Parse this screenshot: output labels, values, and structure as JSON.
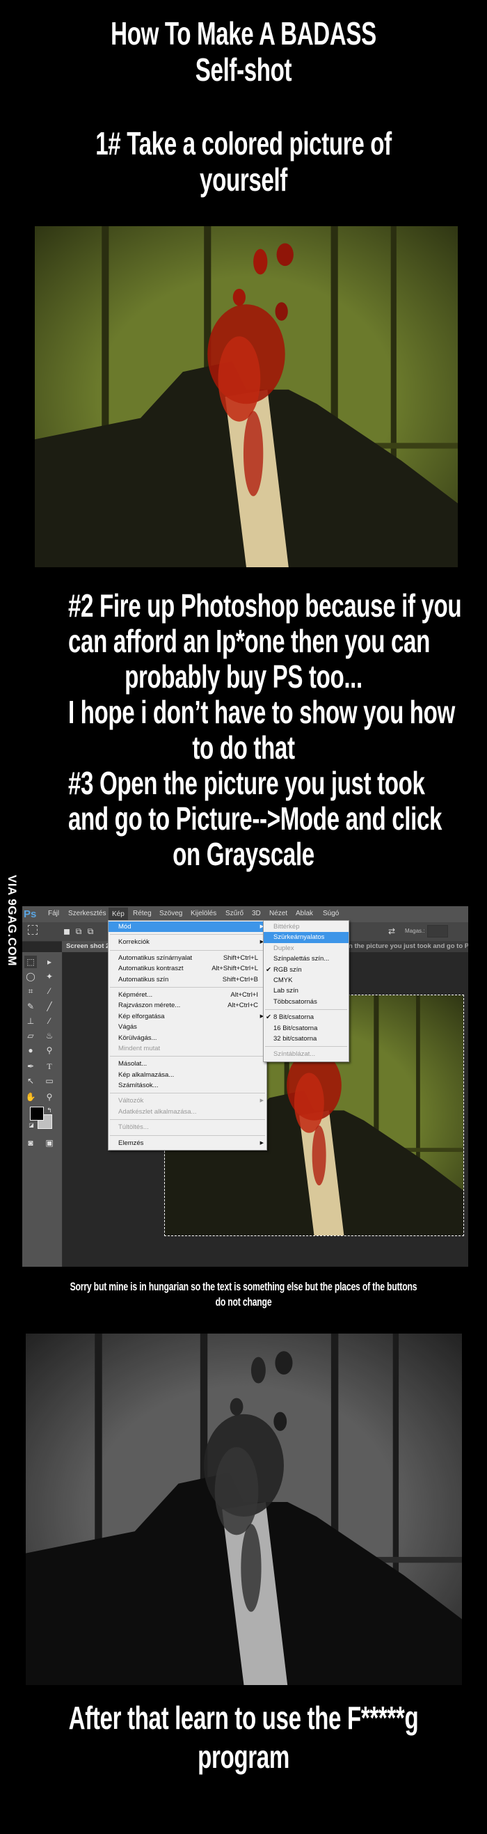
{
  "title_lines": [
    "How To Make A BADASS",
    "Self-shot"
  ],
  "step1_lines": [
    "1# Take a colored picture of",
    "yourself"
  ],
  "step2_lines": [
    "#2 Fire up Photoshop because if you",
    "can afford an Ip*one then you can",
    "probably buy PS too...",
    "I hope i don’t have to show you how",
    "to do that",
    "#3 Open the picture you just took",
    "and go to Picture-->Mode and click",
    "on Grayscale"
  ],
  "watermark": "VIA 9GAG.COM",
  "photoshop": {
    "logo": "Ps",
    "menubar": [
      "Fájl",
      "Szerkesztés",
      "Kép",
      "Réteg",
      "Szöveg",
      "Kijelölés",
      "Szűrő",
      "3D",
      "Nézet",
      "Ablak",
      "Súgó"
    ],
    "active_menu": "Kép",
    "options": {
      "height_label": "Magas.:"
    },
    "tab_label": "Screen shot 2",
    "tab_overflow_text": "n the picture you just took and go to Pic",
    "kep_menu": [
      {
        "label": "Mód",
        "submenu": true,
        "highlighted": true
      },
      {
        "sep": true
      },
      {
        "label": "Korrekciók",
        "submenu": true
      },
      {
        "sep": true
      },
      {
        "label": "Automatikus színárnyalat",
        "shortcut": "Shift+Ctrl+L"
      },
      {
        "label": "Automatikus kontraszt",
        "shortcut": "Alt+Shift+Ctrl+L"
      },
      {
        "label": "Automatikus szín",
        "shortcut": "Shift+Ctrl+B"
      },
      {
        "sep": true
      },
      {
        "label": "Képméret...",
        "shortcut": "Alt+Ctrl+I"
      },
      {
        "label": "Rajzvászon mérete...",
        "shortcut": "Alt+Ctrl+C"
      },
      {
        "label": "Kép elforgatása",
        "submenu": true
      },
      {
        "label": "Vágás"
      },
      {
        "label": "Körülvágás..."
      },
      {
        "label": "Mindent mutat",
        "disabled": true
      },
      {
        "sep": true
      },
      {
        "label": "Másolat..."
      },
      {
        "label": "Kép alkalmazása..."
      },
      {
        "label": "Számítások..."
      },
      {
        "sep": true
      },
      {
        "label": "Változók",
        "submenu": true,
        "disabled": true
      },
      {
        "label": "Adatkészlet alkalmazása...",
        "disabled": true
      },
      {
        "sep": true
      },
      {
        "label": "Túltöltés...",
        "disabled": true
      },
      {
        "sep": true
      },
      {
        "label": "Elemzés",
        "submenu": true
      }
    ],
    "mode_submenu": [
      {
        "label": "Bittérkép",
        "disabled": true
      },
      {
        "label": "Szürkeárnyalatos",
        "highlighted": true
      },
      {
        "label": "Duplex",
        "disabled": true
      },
      {
        "label": "Színpalettás szín..."
      },
      {
        "label": "RGB szín",
        "checked": true
      },
      {
        "label": "CMYK"
      },
      {
        "label": "Lab szín"
      },
      {
        "label": "Többcsatornás"
      },
      {
        "sep": true
      },
      {
        "label": "8 Bit/csatorna",
        "checked": true
      },
      {
        "label": "16 Bit/csatorna"
      },
      {
        "label": "32 bit/csatorna"
      },
      {
        "sep": true
      },
      {
        "label": "Színtáblázat...",
        "disabled": true
      }
    ],
    "highlight_color": "#3d95e8"
  },
  "caption_lines": [
    "Sorry but mine is in hungarian so the text is something else but the places of the buttons",
    "do not change"
  ],
  "final_lines": [
    "After that learn to use the F*****g",
    "program"
  ]
}
